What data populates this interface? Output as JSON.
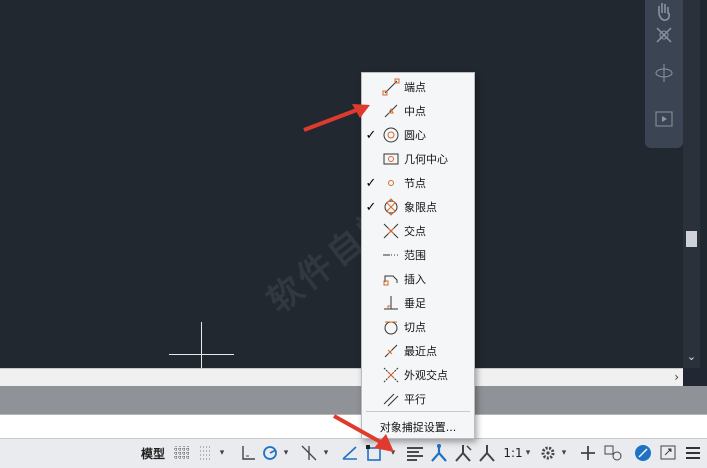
{
  "statusbar": {
    "model_label": "模型",
    "scale_label": "1:1"
  },
  "snap_menu": {
    "items": [
      {
        "label": "端点",
        "checked": false,
        "icon": "endpoint-icon"
      },
      {
        "label": "中点",
        "checked": false,
        "icon": "midpoint-icon"
      },
      {
        "label": "圆心",
        "checked": true,
        "icon": "center-icon"
      },
      {
        "label": "几何中心",
        "checked": false,
        "icon": "geometric-center-icon"
      },
      {
        "label": "节点",
        "checked": true,
        "icon": "node-icon"
      },
      {
        "label": "象限点",
        "checked": true,
        "icon": "quadrant-icon"
      },
      {
        "label": "交点",
        "checked": false,
        "icon": "intersection-icon"
      },
      {
        "label": "范围",
        "checked": false,
        "icon": "extension-icon"
      },
      {
        "label": "插入",
        "checked": false,
        "icon": "insertion-icon"
      },
      {
        "label": "垂足",
        "checked": false,
        "icon": "perpendicular-icon"
      },
      {
        "label": "切点",
        "checked": false,
        "icon": "tangent-icon"
      },
      {
        "label": "最近点",
        "checked": false,
        "icon": "nearest-icon"
      },
      {
        "label": "外观交点",
        "checked": false,
        "icon": "apparent-intersection-icon"
      },
      {
        "label": "平行",
        "checked": false,
        "icon": "parallel-icon"
      }
    ],
    "settings_label": "对象捕捉设置..."
  },
  "colors": {
    "canvas": "#212830",
    "accent_orange": "#d46a2c",
    "annotation_red": "#e03a2e",
    "status_blue": "#1d72c4"
  }
}
